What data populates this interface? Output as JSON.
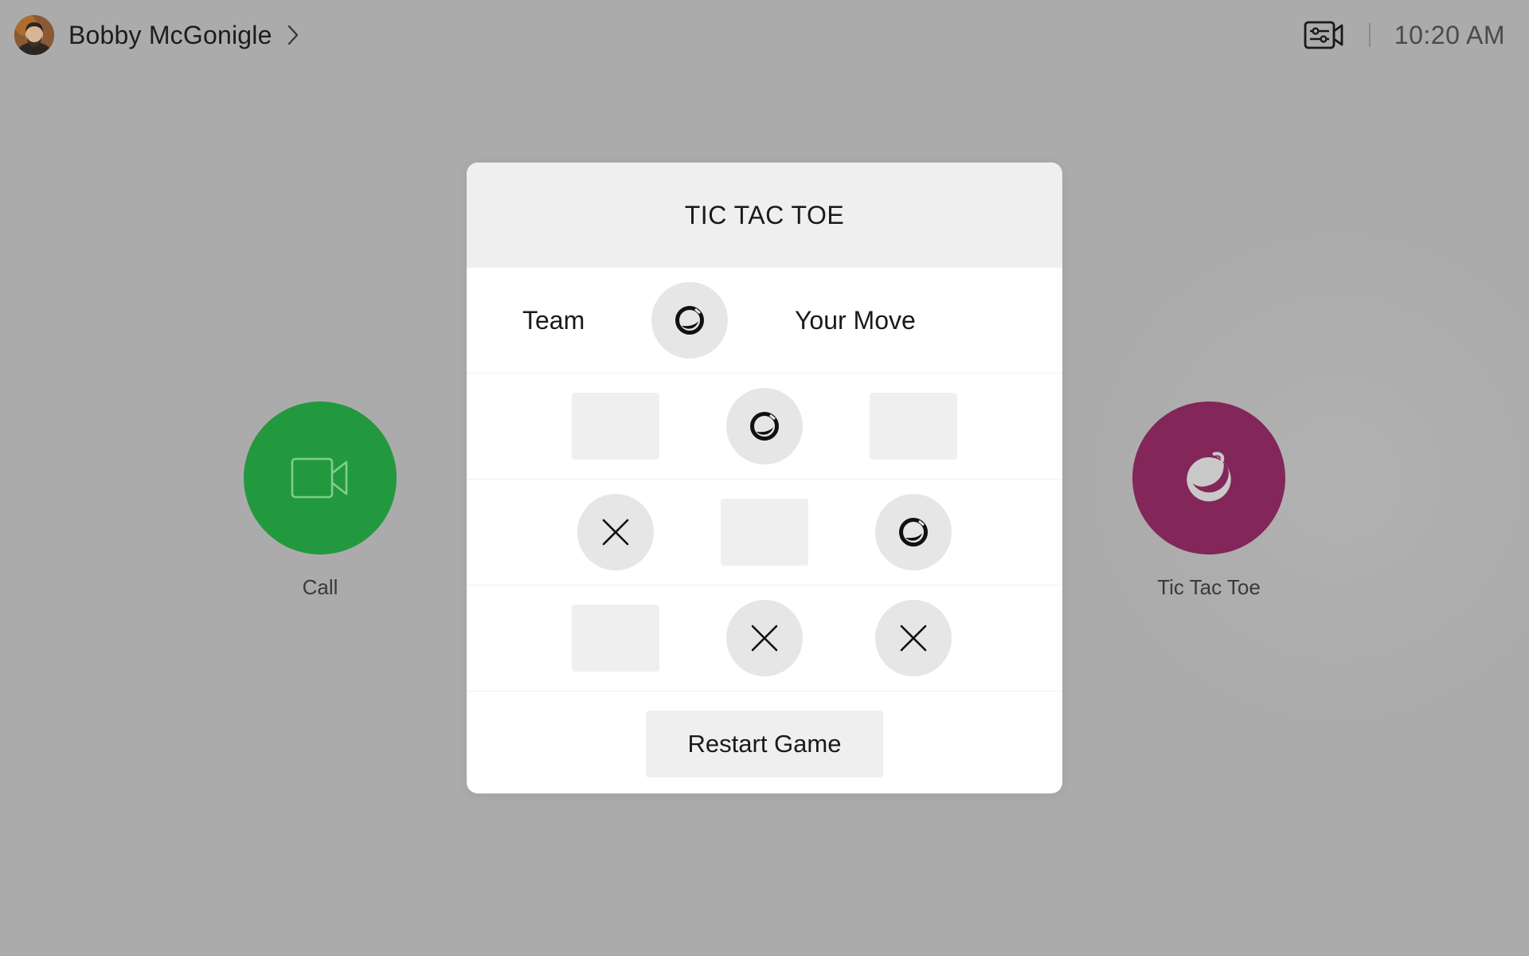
{
  "header": {
    "user_name": "Bobby McGonigle",
    "time": "10:20 AM",
    "icons": {
      "avatar": "user-avatar",
      "chevron": "chevron-right-icon",
      "camera_settings": "camera-settings-icon"
    }
  },
  "home_tiles": [
    {
      "label": "Call",
      "icon": "video-camera-icon",
      "color": "#23993f"
    },
    {
      "label": "Tic Tac Toe",
      "icon": "team-logo-icon",
      "color": "#832659"
    }
  ],
  "game": {
    "title": "TIC TAC TOE",
    "status": {
      "team_label": "Team",
      "team_icon": "team-logo-icon",
      "move_label": "Your Move"
    },
    "board": [
      [
        "",
        "O",
        ""
      ],
      [
        "X",
        "",
        "O"
      ],
      [
        "",
        "X",
        "X"
      ]
    ],
    "restart_label": "Restart Game"
  },
  "colors": {
    "background": "#ababab",
    "call_green": "#23993f",
    "game_magenta": "#832659",
    "cell_empty": "#efefef",
    "cell_marked": "#e6e6e6"
  }
}
